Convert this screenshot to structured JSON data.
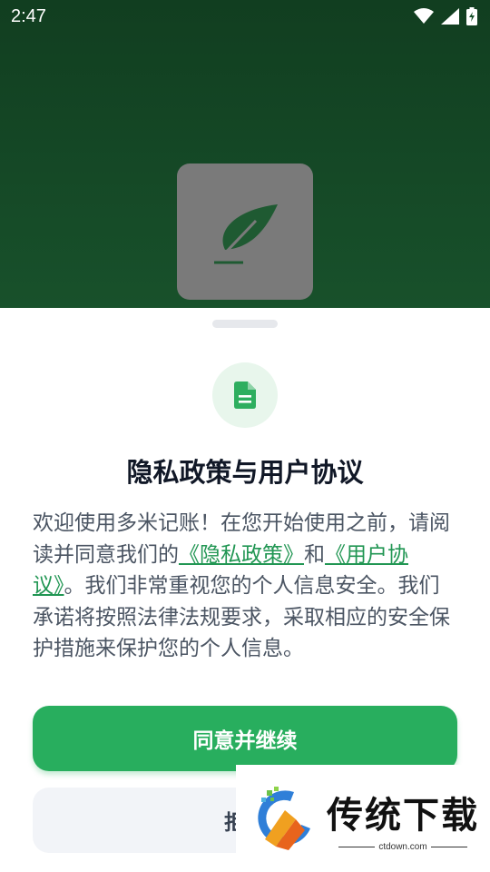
{
  "status_bar": {
    "time": "2:47"
  },
  "dialog": {
    "title": "隐私政策与用户协议",
    "body_before": "欢迎使用多米记账！在您开始使用之前，请阅读并同意我们的",
    "privacy_link": "《隐私政策》",
    "body_and": "和",
    "terms_link": "《用户协议》",
    "body_after": "。我们非常重视您的个人信息安全。我们承诺将按照法律法规要求，采取相应的安全保护措施来保护您的个人信息。",
    "agree_label": "同意并继续",
    "reject_label": "拒绝"
  },
  "watermark": {
    "brand": "传统下载",
    "url": "ctdown.com"
  },
  "colors": {
    "header_green": "#113e20",
    "accent_green": "#28ae5e",
    "link_green": "#219653",
    "icon_green": "#2eae5f"
  }
}
